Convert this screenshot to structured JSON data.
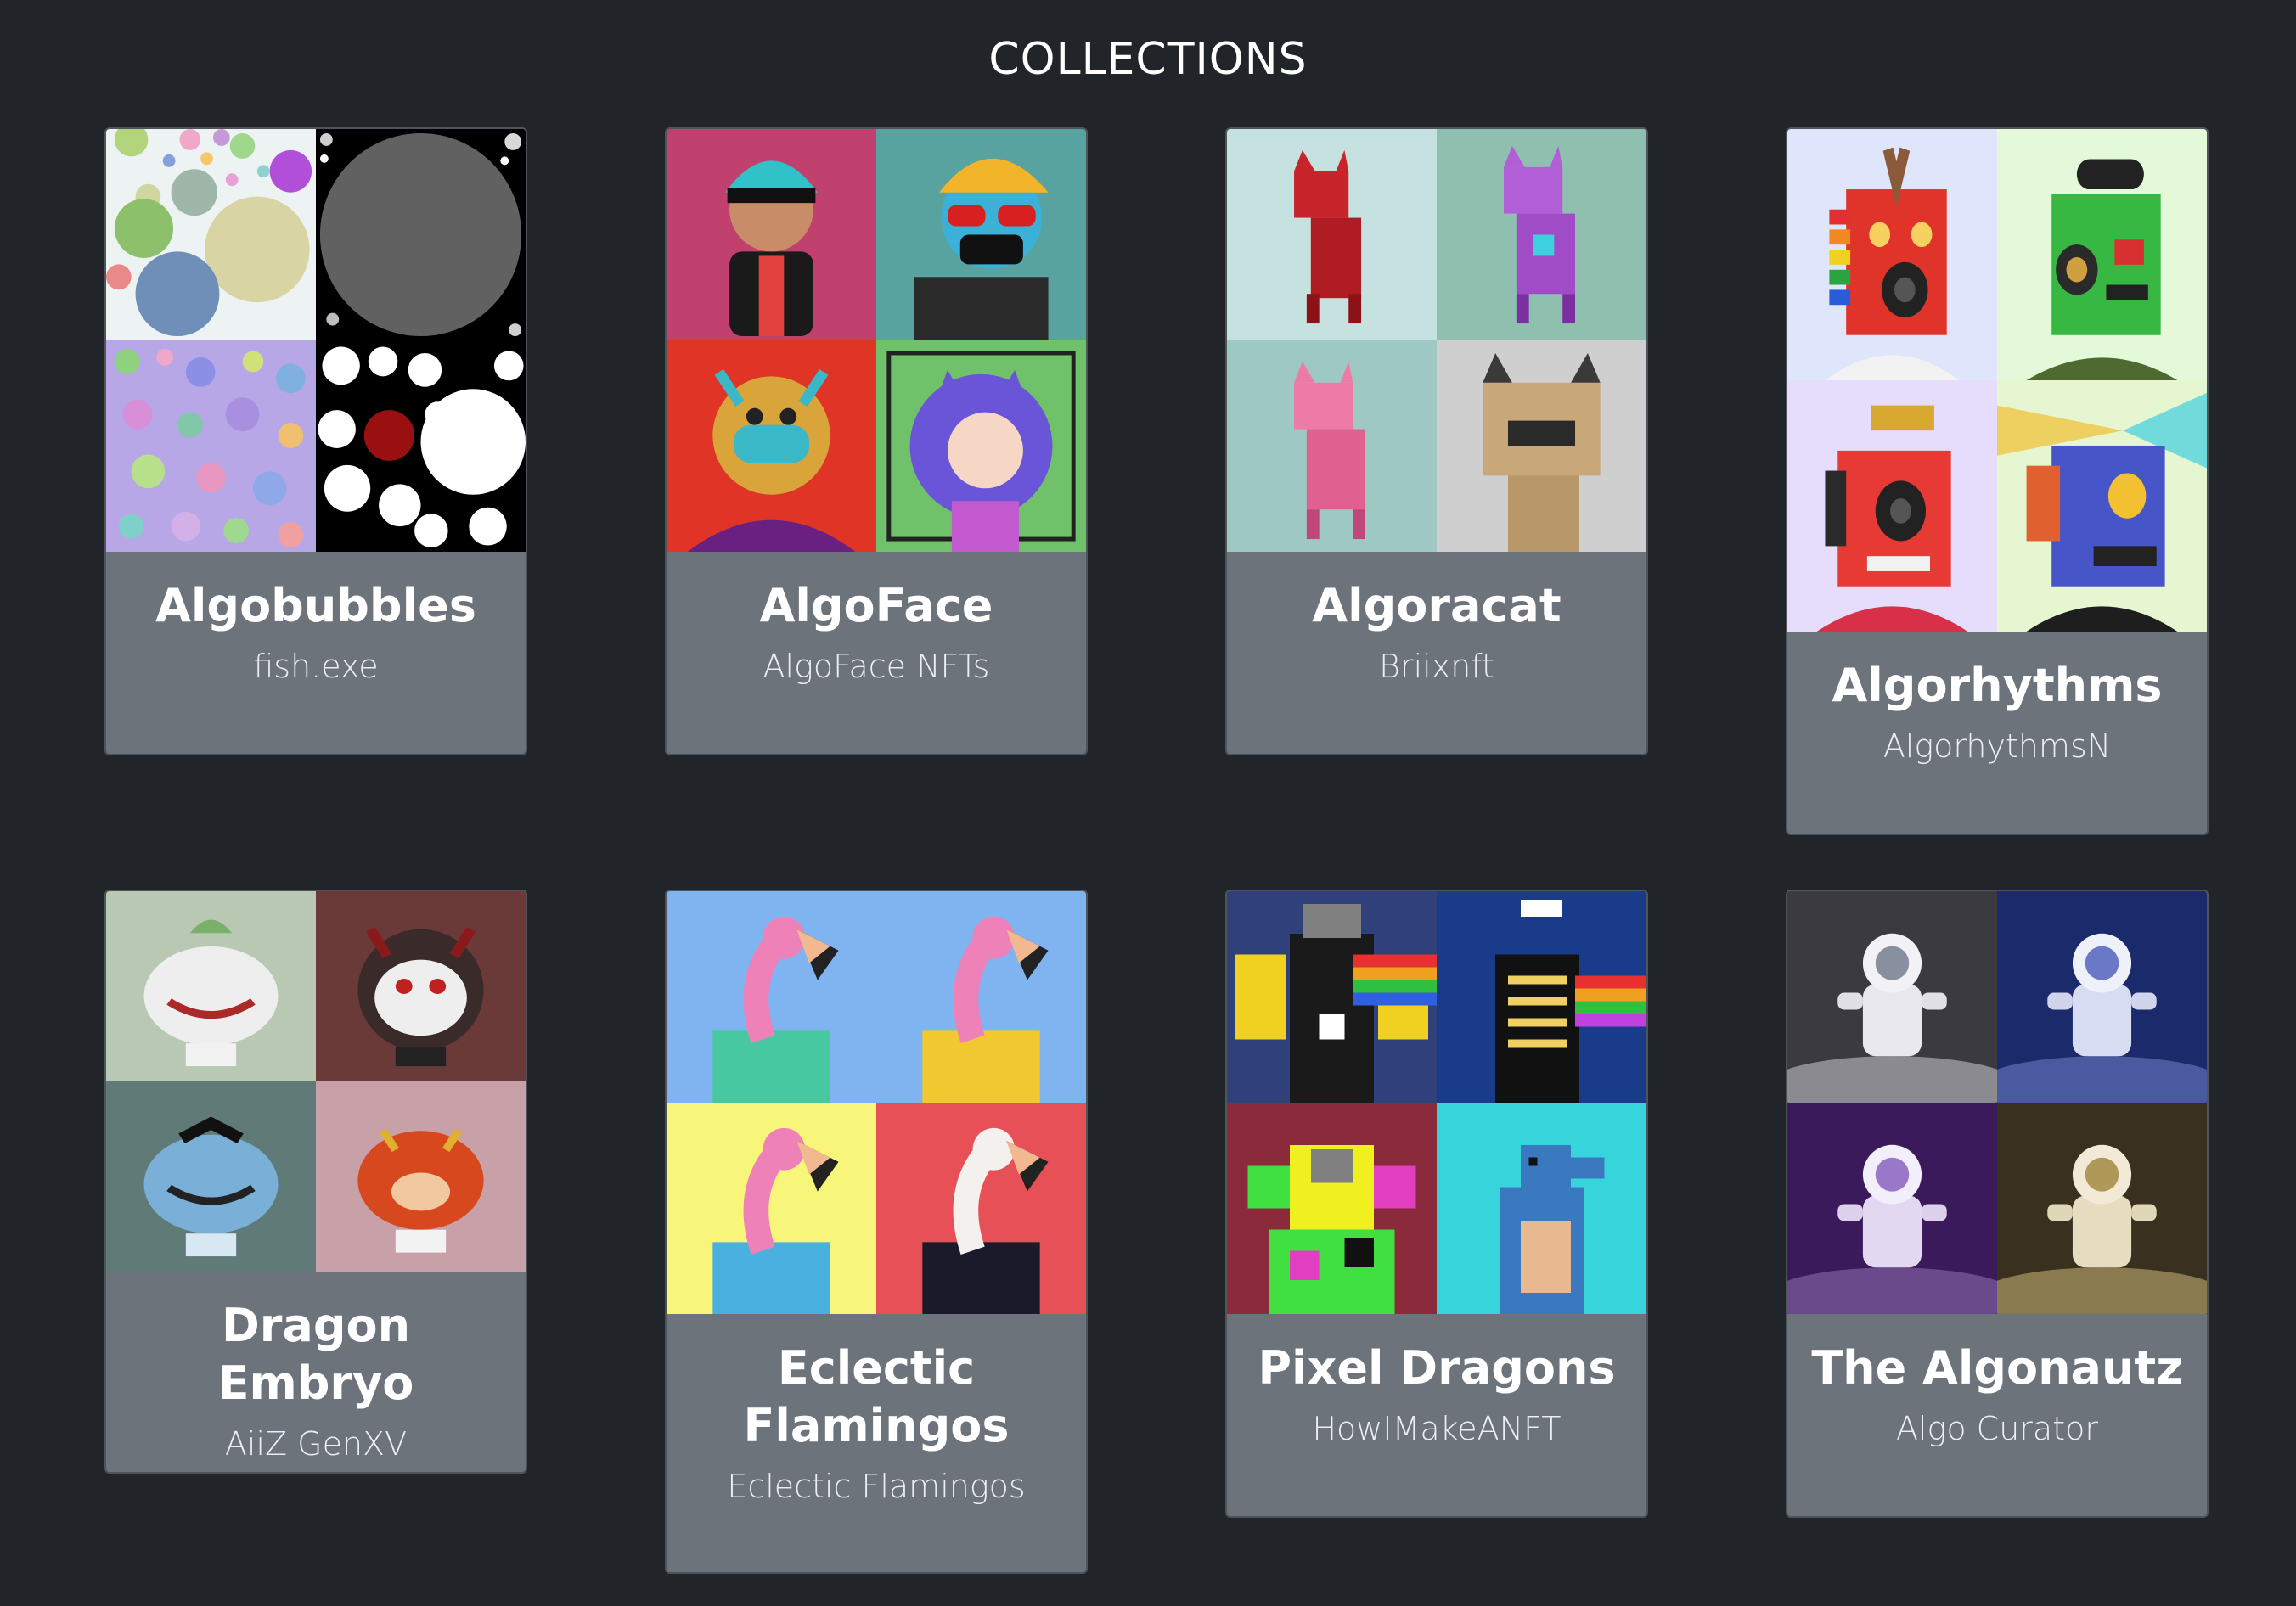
{
  "page": {
    "title": "COLLECTIONS",
    "background": "#212429",
    "card_background": "#6d737b"
  },
  "collections": [
    {
      "name": "Algobubbles",
      "creator": "fish.exe",
      "thumbs": [
        "bubbles-pastel-image",
        "bubbles-gray-image",
        "bubbles-confetti-image",
        "bubbles-white-image"
      ]
    },
    {
      "name": "AlgoFace",
      "creator": "AlgoFace NFTs",
      "thumbs": [
        "face-headband-image",
        "face-sunglasses-image",
        "face-tribal-mask-image",
        "face-cat-girl-image"
      ]
    },
    {
      "name": "Algoracat",
      "creator": "Briixnft",
      "thumbs": [
        "cat-red-image",
        "cat-purple-image",
        "cat-pink-image",
        "cat-tan-image"
      ]
    },
    {
      "name": "Algorhythms",
      "creator": "AlgorhythmsN",
      "thumbs": [
        "boombox-red-image",
        "boombox-green-image",
        "boombox-trumpet-image",
        "boombox-blue-image"
      ]
    },
    {
      "name": "Dragon Embryo",
      "creator": "AiiZ GenXV",
      "thumbs": [
        "embryo-white-image",
        "embryo-dark-red-image",
        "embryo-blue-image",
        "embryo-orange-image"
      ]
    },
    {
      "name": "Eclectic Flamingos",
      "creator": "Eclectic Flamingos",
      "thumbs": [
        "flamingo-blue-bg-image",
        "flamingo-blue-bg-2-image",
        "flamingo-yellow-bg-image",
        "flamingo-red-bg-image"
      ]
    },
    {
      "name": "Pixel Dragons",
      "creator": "HowIMakeANFT",
      "thumbs": [
        "dragon-yellow-wings-image",
        "dragon-skeleton-image",
        "dragon-glitch-image",
        "dragon-blue-image"
      ]
    },
    {
      "name": "The Algonautz",
      "creator": "Algo Curator",
      "thumbs": [
        "astronaut-gray-image",
        "astronaut-blue-image",
        "astronaut-purple-image",
        "astronaut-gold-image"
      ]
    }
  ]
}
